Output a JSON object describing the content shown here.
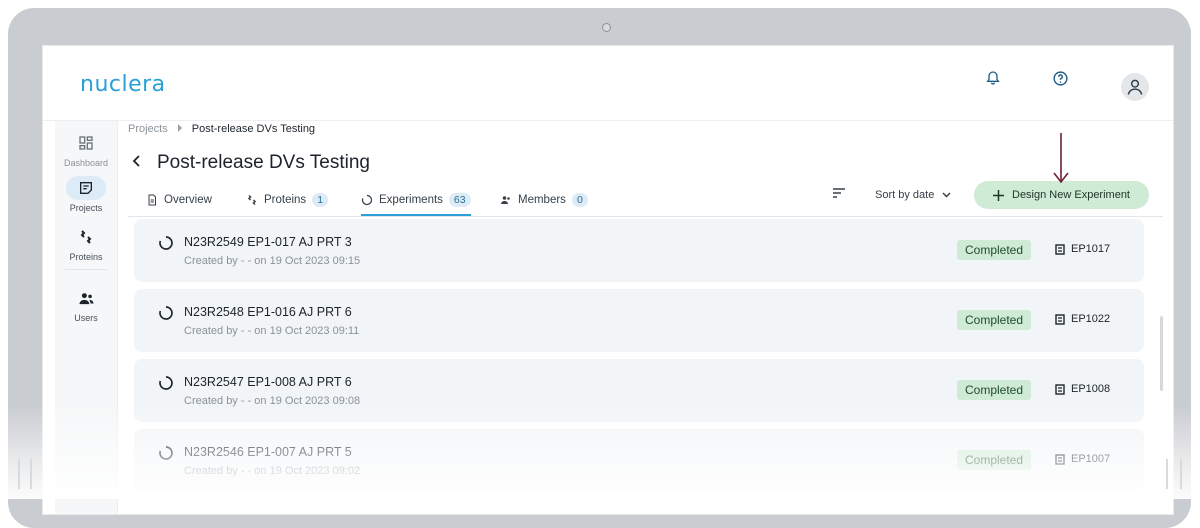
{
  "app": {
    "logo": "nuclera"
  },
  "header": {
    "icons": [
      "bell-icon",
      "help-icon",
      "user-icon"
    ]
  },
  "sidebar": {
    "items": [
      {
        "label": "Dashboard",
        "icon": "dashboard-icon",
        "active": false
      },
      {
        "label": "Projects",
        "icon": "projects-icon",
        "active": true
      },
      {
        "label": "Proteins",
        "icon": "proteins-icon",
        "active": false
      },
      {
        "label": "Users",
        "icon": "users-icon",
        "active": false
      }
    ]
  },
  "breadcrumb": {
    "root": "Projects",
    "current": "Post-release DVs Testing"
  },
  "page": {
    "title": "Post-release DVs Testing"
  },
  "tabs": [
    {
      "label": "Overview",
      "count": "",
      "icon": "document-icon"
    },
    {
      "label": "Proteins",
      "count": "1",
      "icon": "protein-icon"
    },
    {
      "label": "Experiments",
      "count": "63",
      "icon": "spinner-icon",
      "active": true
    },
    {
      "label": "Members",
      "count": "0",
      "icon": "members-icon"
    }
  ],
  "toolbar": {
    "sort_label": "Sort by date",
    "design_button": "Design New Experiment"
  },
  "experiments": [
    {
      "name": "N23R2549 EP1-017 AJ PRT 3",
      "meta": "Created by - - on 19 Oct 2023 09:15",
      "status": "Completed",
      "code": "EP1017"
    },
    {
      "name": "N23R2548 EP1-016 AJ PRT 6",
      "meta": "Created by - - on 19 Oct 2023 09:11",
      "status": "Completed",
      "code": "EP1022"
    },
    {
      "name": "N23R2547 EP1-008 AJ PRT 6",
      "meta": "Created by - - on 19 Oct 2023 09:08",
      "status": "Completed",
      "code": "EP1008"
    },
    {
      "name": "N23R2546 EP1-007 AJ PRT 5",
      "meta": "Created by - - on 19 Oct 2023 09:02",
      "status": "Completed",
      "code": "EP1007"
    }
  ],
  "colors": {
    "brand": "#2a9fd8",
    "completed_bg": "#cfead5",
    "annotation_arrow": "#6b2136"
  }
}
